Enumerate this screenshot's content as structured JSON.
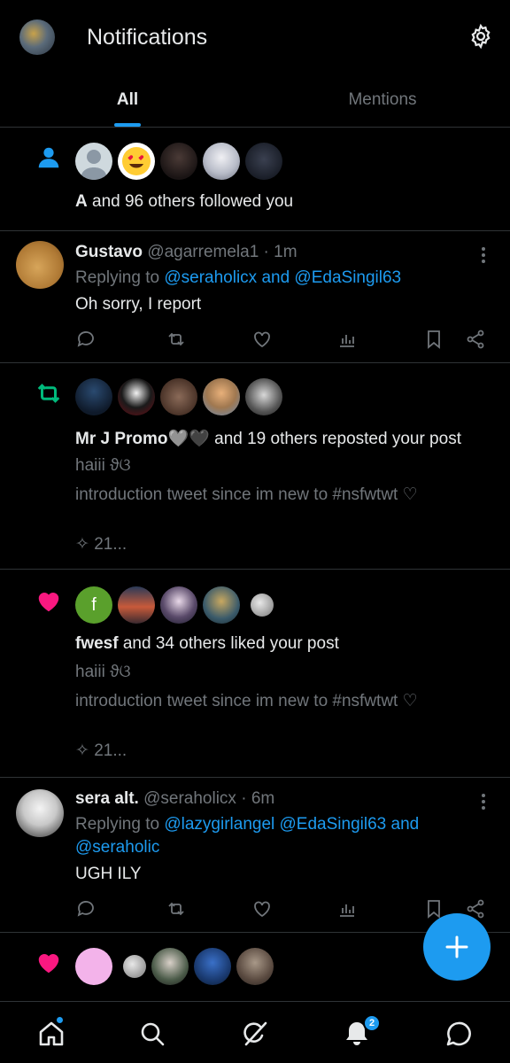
{
  "header": {
    "title": "Notifications"
  },
  "tabs": [
    {
      "label": "All"
    },
    {
      "label": "Mentions"
    }
  ],
  "notifications": {
    "follow": {
      "name": "A",
      "rest": "and 96 others followed you"
    },
    "reply1": {
      "name": "Gustavo",
      "handle": "@agarremela1 · 1m",
      "replying_prefix": "Replying to",
      "replying_to": "@seraholicx and @EdaSingil63",
      "text": "Oh sorry, I report"
    },
    "repost": {
      "name": "Mr J Promo🩶🖤",
      "rest": "and 19 others reposted your post",
      "line1": "haiii ϑଓ",
      "line2": "introduction tweet since im new to #nsfwtwt ♡",
      "meta": "✧ 21..."
    },
    "like": {
      "name": "fwesf",
      "rest": "and 34 others liked your post",
      "line1": "haiii ϑଓ",
      "line2": "introduction tweet since im new to #nsfwtwt ♡",
      "meta": "✧ 21...",
      "avatar_letter": "f"
    },
    "reply2": {
      "name": "sera alt.",
      "handle": "@seraholicx · 6m",
      "replying_prefix": "Replying to",
      "replying_to_line1": "@lazygirlangel @EdaSingil63 and",
      "replying_to_line2": "@seraholic",
      "text": "UGH ILY"
    }
  },
  "nav": {
    "notifications_badge": "2"
  },
  "colors": {
    "accent": "#1d9bf0",
    "like": "#f91880",
    "repost": "#00ba7c",
    "muted": "#71767b"
  }
}
